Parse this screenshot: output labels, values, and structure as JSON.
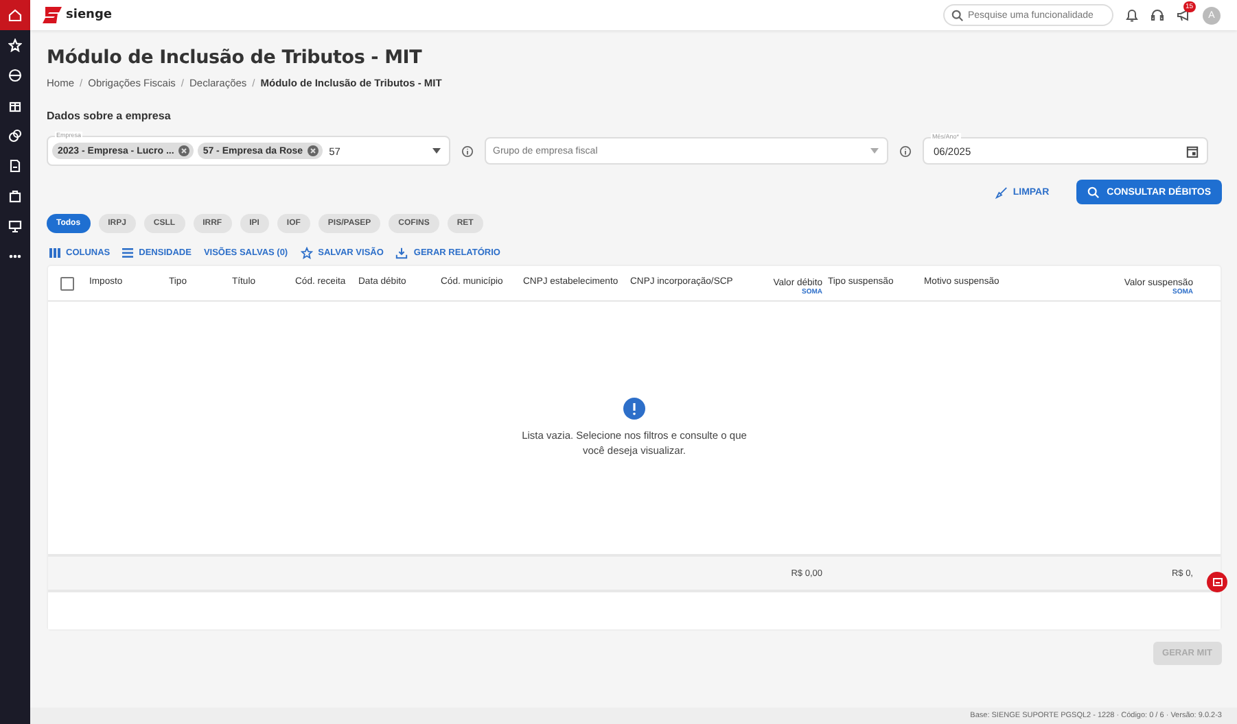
{
  "sidebar": {
    "items": [
      {
        "selected": true
      },
      {
        "selected": false
      },
      {
        "selected": false
      },
      {
        "selected": false
      },
      {
        "selected": false
      },
      {
        "selected": false
      },
      {
        "selected": false
      },
      {
        "selected": false
      },
      {
        "selected": false
      }
    ]
  },
  "header": {
    "logo": "sienge",
    "search": {
      "placeholder": "Pesquise uma funcionalidade"
    },
    "notification_badge": "15",
    "avatar": "A"
  },
  "page": {
    "title": "Módulo de Inclusão de Tributos - MIT",
    "breadcrumb": [
      {
        "label": "Home"
      },
      {
        "separator": "/",
        "label": "Obrigações Fiscais"
      },
      {
        "separator": "/",
        "label": "Declarações"
      },
      {
        "separator": "/",
        "label": "Módulo de Inclusão de Tributos - MIT"
      }
    ],
    "section_title": "Dados sobre a empresa"
  },
  "filters": {
    "empresa": {
      "label": "Empresa",
      "chips": [
        "2023 - Empresa - Lucro ...",
        "57 - Empresa da Rose"
      ],
      "value": "57"
    },
    "grupo": {
      "placeholder": "Grupo de empresa fiscal"
    },
    "mes_ano": {
      "label": "Mês/Ano*",
      "value": "06/2025"
    }
  },
  "actions": {
    "clear": "LIMPAR",
    "search": "CONSULTAR DÉBITOS"
  },
  "tabs": [
    {
      "label": "Todos",
      "selected": true
    },
    {
      "label": "IRPJ",
      "selected": false
    },
    {
      "label": "CSLL",
      "selected": false
    },
    {
      "label": "IRRF",
      "selected": false
    },
    {
      "label": "IPI",
      "selected": false
    },
    {
      "label": "IOF",
      "selected": false
    },
    {
      "label": "PIS/PASEP",
      "selected": false
    },
    {
      "label": "COFINS",
      "selected": false
    },
    {
      "label": "RET",
      "selected": false
    }
  ],
  "toolbar": [
    {
      "kind": "columns",
      "label": "COLUNAS"
    },
    {
      "kind": "density",
      "label": "DENSIDADE"
    },
    {
      "kind": "views",
      "label": "VISÕES SALVAS (0)"
    },
    {
      "kind": "save",
      "label": "SALVAR VISÃO"
    },
    {
      "kind": "report",
      "label": "GERAR RELATÓRIO"
    }
  ],
  "table": {
    "select_all": {
      "checked": false
    },
    "columns": [
      {
        "label": "Imposto",
        "numeric": false
      },
      {
        "label": "Tipo",
        "numeric": false
      },
      {
        "label": "Título",
        "numeric": false
      },
      {
        "label": "Cód. receita",
        "numeric": false
      },
      {
        "label": "Data débito",
        "numeric": false
      },
      {
        "label": "Cód. município",
        "numeric": false
      },
      {
        "label": "CNPJ estabelecimento",
        "numeric": false
      },
      {
        "label": "CNPJ incorporação/SCP",
        "numeric": false
      },
      {
        "label": "Valor débito",
        "numeric": true,
        "sum_label": "SOMA",
        "total": "R$ 0,00"
      },
      {
        "label": "Tipo suspensão",
        "numeric": false
      },
      {
        "label": "Motivo suspensão",
        "numeric": false
      },
      {
        "label": "Valor suspensão",
        "numeric": true,
        "sum_label": "SOMA",
        "total": "R$ 0,"
      }
    ],
    "empty_message": "Lista vazia. Selecione nos filtros e consulte o que você deseja visualizar."
  },
  "submit": {
    "label": "GERAR MIT",
    "disabled": true
  },
  "status_bar": "Base: SIENGE SUPORTE PGSQL2 - 1228 · Código: 0 / 6 · Versão: 9.0.2-3"
}
